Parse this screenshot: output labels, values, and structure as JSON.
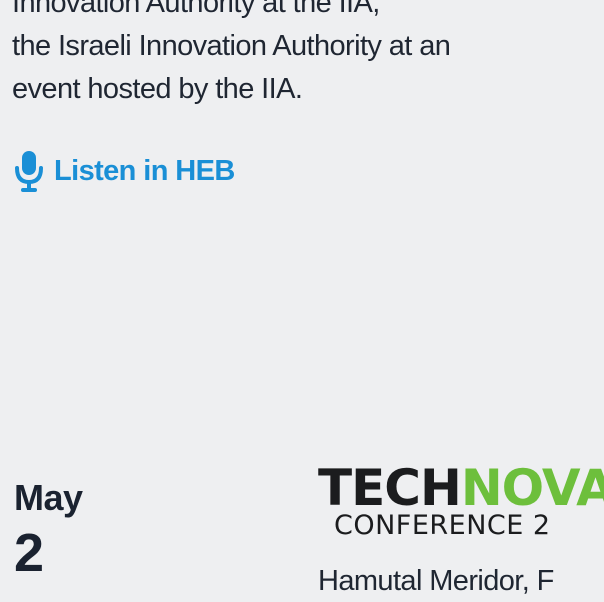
{
  "event1": {
    "description_lines": [
      "Innovation Authority at the IIA,",
      "the Israeli Innovation Authority at an",
      "event hosted by the IIA."
    ],
    "listen_label": "Listen in HEB",
    "listen_icon": "microphone-icon",
    "link_color": "#1a8fd6"
  },
  "event2": {
    "month": "May",
    "day": "2",
    "logo": {
      "word_part1": "TECH",
      "word_part2": "NOVA",
      "subtitle": "CONFERENCE 2",
      "color_dark": "#1b1c1e",
      "color_green": "#6dbf3c"
    },
    "speaker_text": "Hamutal Meridor, F"
  }
}
